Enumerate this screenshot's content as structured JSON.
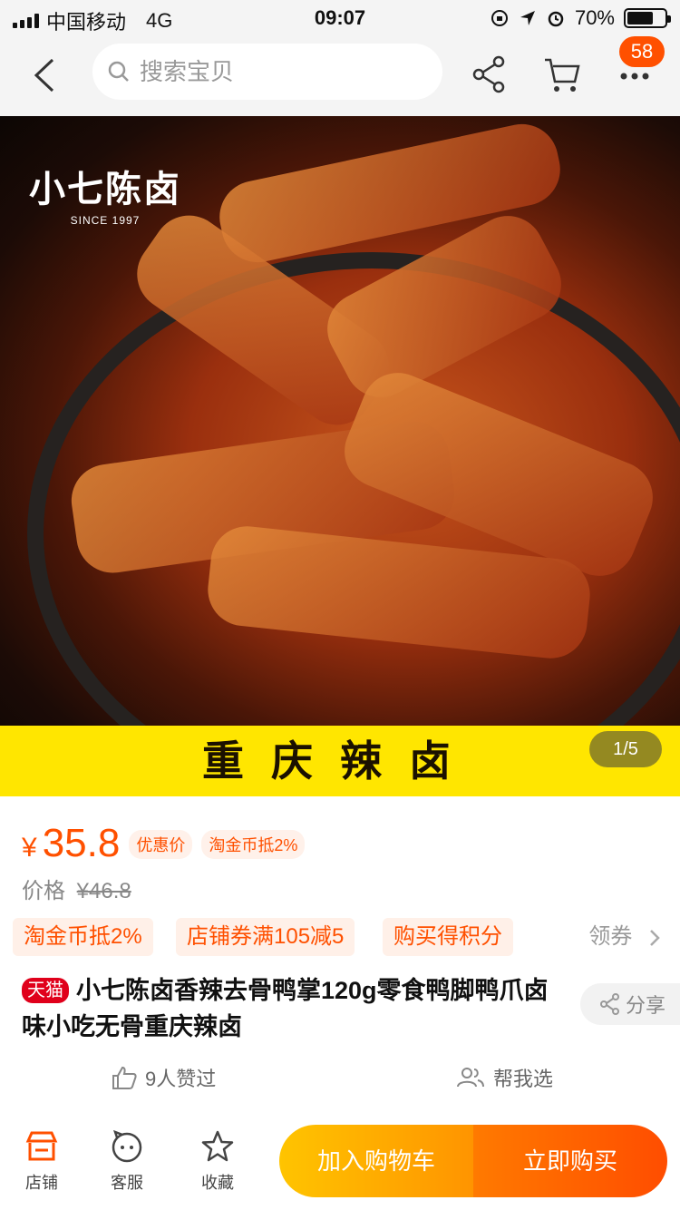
{
  "status_bar": {
    "carrier": "中国移动",
    "network": "4G",
    "time": "09:07",
    "battery": "70%",
    "battery_level": 0.7
  },
  "nav": {
    "search_placeholder": "搜索宝贝",
    "more_badge": "58"
  },
  "product_image": {
    "brand_name": "小七陈卤",
    "brand_since": "SINCE 1997",
    "banner_text": "重庆辣卤",
    "counter": "1/5"
  },
  "price": {
    "currency": "¥",
    "value": "35.8",
    "tag_discount": "优惠价",
    "tag_coin": "淘金币抵2%",
    "original_label": "价格",
    "original_value": "¥46.8"
  },
  "promotions": {
    "items": [
      "淘金币抵2%",
      "店铺券满105减5",
      "购买得积分"
    ],
    "coupon_link": "领券"
  },
  "product": {
    "badge": "天猫",
    "title": "小七陈卤香辣去骨鸭掌120g零食鸭脚鸭爪卤味小吃无骨重庆辣卤",
    "share_label": "分享"
  },
  "social": {
    "likes": "9人赞过",
    "help_choose": "帮我选"
  },
  "bottom_bar": {
    "shop": "店铺",
    "service": "客服",
    "favorite": "收藏",
    "add_to_cart": "加入购物车",
    "buy_now": "立即购买"
  },
  "colors": {
    "accent": "#ff5000",
    "banner": "#ffe600",
    "tmall": "#e0001b"
  },
  "icons": [
    "back-icon",
    "search-icon",
    "share-icon",
    "cart-icon",
    "more-icon",
    "like-icon",
    "people-icon",
    "shop-icon",
    "service-icon",
    "star-icon"
  ]
}
